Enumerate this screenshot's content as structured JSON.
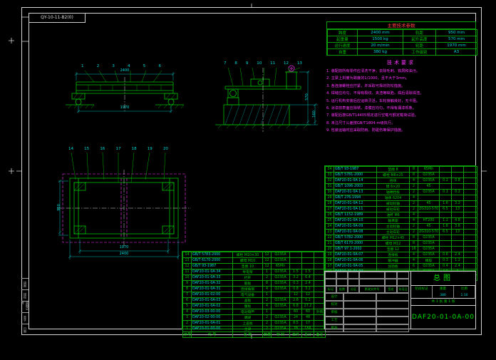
{
  "page": {
    "zone_label": "QY-10-11-B2(0)"
  },
  "spec_table": {
    "title": "主要技术参数",
    "rows": [
      [
        "跨度",
        "2400 mm",
        "轨距",
        "950 mm"
      ],
      [
        "起重量",
        "1500 kg",
        "起升高度",
        "570 mm"
      ],
      [
        "运行速度",
        "20 m/min",
        "轮距",
        "1970 mm"
      ],
      [
        "自重",
        "380 kg",
        "工作级别",
        "A3"
      ]
    ]
  },
  "notes": {
    "title": "技术要求",
    "items": [
      "1. 装配前所有零件应清洗干净，去除毛刺、铁屑和油污。",
      "2. 主梁上拱度为跨度的1/1000，且不大于3mm。",
      "3. 各连接螺栓应拧紧，并采取可靠的防松措施。",
      "4. 焊缝应均匀，不得有裂纹、夹渣等缺陷，焊后清除焊渣。",
      "5. 运行机构安装后应运转灵活，车轮接触良好，无卡阻。",
      "6. 涂漆前表面应除锈，漆膜应均匀，不得有漏漆现象。",
      "7. 装配后按GB/T14405规定进行空载与额定载荷试验。",
      "8. 未注尺寸公差按GB/T1804-m级执行。",
      "9. 包装运输时应采取防雨、防碰伤等保护措施。"
    ]
  },
  "bom_right": {
    "rows": [
      {
        "no": "34",
        "code": "GB/T 93-1987",
        "name": "垫圈 8",
        "qty": "8",
        "mat": "65Mn",
        "w1": "",
        "w2": "",
        "rem": ""
      },
      {
        "no": "33",
        "code": "GB/T 5781-2000",
        "name": "螺栓 M8×25",
        "qty": "8",
        "mat": "Q235A",
        "w1": "",
        "w2": "",
        "rem": ""
      },
      {
        "no": "32",
        "code": "DAF20-01-0A-14",
        "name": "挡块",
        "qty": "4",
        "mat": "Q235A",
        "w1": "0.2",
        "w2": "0.8",
        "rem": ""
      },
      {
        "no": "31",
        "code": "GB/T 1096-2003",
        "name": "键 6×20",
        "qty": "2",
        "mat": "45",
        "w1": "",
        "w2": "",
        "rem": ""
      },
      {
        "no": "30",
        "code": "DAF20-01-0A-13",
        "name": "轴端挡板",
        "qty": "2",
        "mat": "Q235A",
        "w1": "0.1",
        "w2": "0.2",
        "rem": ""
      },
      {
        "no": "29",
        "code": "GB/T 276-1994",
        "name": "轴承 6204",
        "qty": "4",
        "mat": "",
        "w1": "",
        "w2": "",
        "rem": ""
      },
      {
        "no": "28",
        "code": "DAF20-01-0A-12",
        "name": "被动轮轴",
        "qty": "2",
        "mat": "45",
        "w1": "1.6",
        "w2": "3.2",
        "rem": ""
      },
      {
        "no": "27",
        "code": "DAF20-01-0A-11",
        "name": "被动车轮",
        "qty": "2",
        "mat": "ZG310-570",
        "w1": "6.5",
        "w2": "13",
        "rem": ""
      },
      {
        "no": "26",
        "code": "GB/T 1152-1989",
        "name": "油杯 M6",
        "qty": "4",
        "mat": "",
        "w1": "",
        "w2": "",
        "rem": ""
      },
      {
        "no": "25",
        "code": "DAF20-01-0A-10",
        "name": "轴承座",
        "qty": "4",
        "mat": "HT200",
        "w1": "1.2",
        "w2": "4.8",
        "rem": ""
      },
      {
        "no": "24",
        "code": "DAF20-01-0A-09",
        "name": "主动轮轴",
        "qty": "2",
        "mat": "45",
        "w1": "1.8",
        "w2": "3.6",
        "rem": ""
      },
      {
        "no": "23",
        "code": "DAF20-01-0A-08",
        "name": "主动车轮",
        "qty": "2",
        "mat": "ZG310-570",
        "w1": "6.5",
        "w2": "13",
        "rem": ""
      },
      {
        "no": "22",
        "code": "GB/T 5782-2000",
        "name": "螺栓 M12×45",
        "qty": "8",
        "mat": "Q235A",
        "w1": "",
        "w2": "",
        "rem": ""
      },
      {
        "no": "21",
        "code": "GB/T 6170-2000",
        "name": "螺母 M12",
        "qty": "8",
        "mat": "Q235A",
        "w1": "",
        "w2": "",
        "rem": ""
      },
      {
        "no": "20",
        "code": "GB/T 97.1-2002",
        "name": "垫圈 12",
        "qty": "16",
        "mat": "Q235A",
        "w1": "",
        "w2": "",
        "rem": ""
      },
      {
        "no": "19",
        "code": "DAF20-01-0A-07",
        "name": "连接板",
        "qty": "4",
        "mat": "Q235A",
        "w1": "0.6",
        "w2": "2.4",
        "rem": ""
      },
      {
        "no": "18",
        "code": "DAF20-01-0A-06",
        "name": "缓冲器",
        "qty": "4",
        "mat": "橡胶",
        "w1": "0.3",
        "w2": "1.2",
        "rem": ""
      },
      {
        "no": "17",
        "code": "DAF20-01-0A-05",
        "name": "加劲板",
        "qty": "6",
        "mat": "Q235A",
        "w1": "0.4",
        "w2": "2.4",
        "rem": ""
      },
      {
        "no": "16",
        "code": "DAF20-01-0A-04",
        "name": "走台板",
        "qty": "2",
        "mat": "Q235A",
        "w1": "4.5",
        "w2": "9",
        "rem": ""
      },
      {
        "no": "15",
        "code": "DAF20-01-01-00",
        "name": "运行机构",
        "qty": "1",
        "mat": "",
        "w1": "26",
        "w2": "26",
        "rem": "组合件"
      }
    ]
  },
  "bom_left": {
    "header": [
      "序号",
      "代  号",
      "名  称",
      "数量",
      "材  料",
      "单件",
      "总计",
      "备注"
    ],
    "rows": [
      {
        "no": "14",
        "code": "GB/T 5783-2000",
        "name": "螺栓 M10×30",
        "qty": "12",
        "mat": "Q235A",
        "w1": "",
        "w2": "",
        "rem": ""
      },
      {
        "no": "13",
        "code": "GB/T 6170-2000",
        "name": "螺母 M10",
        "qty": "12",
        "mat": "Q235A",
        "w1": "",
        "w2": "",
        "rem": ""
      },
      {
        "no": "12",
        "code": "GB/T 93-1987",
        "name": "垫圈 10",
        "qty": "12",
        "mat": "65Mn",
        "w1": "",
        "w2": "",
        "rem": ""
      },
      {
        "no": "11",
        "code": "DAF20-01-0A-34",
        "name": "导电架",
        "qty": "1",
        "mat": "Q235A",
        "w1": "1.5",
        "w2": "1.5",
        "rem": ""
      },
      {
        "no": "10",
        "code": "DAF20-01-0A-33",
        "name": "栏杆",
        "qty": "2",
        "mat": "Q235A",
        "w1": "3.2",
        "w2": "6.4",
        "rem": ""
      },
      {
        "no": "9",
        "code": "DAF20-01-0A-32",
        "name": "筋板",
        "qty": "8",
        "mat": "Q235A",
        "w1": "0.3",
        "w2": "2.4",
        "rem": ""
      },
      {
        "no": "8",
        "code": "DAF20-01-0A-31",
        "name": "连接角钢",
        "qty": "4",
        "mat": "Q235A",
        "w1": "0.8",
        "w2": "3.2",
        "rem": ""
      },
      {
        "no": "7",
        "code": "DAF20-01-02-00",
        "name": "电气设备",
        "qty": "1",
        "mat": "",
        "w1": "12",
        "w2": "12",
        "rem": ""
      },
      {
        "no": "6",
        "code": "DAF20-01-0A-03",
        "name": "盖板",
        "qty": "2",
        "mat": "Q235A",
        "w1": "2.6",
        "w2": "5.2",
        "rem": ""
      },
      {
        "no": "5",
        "code": "DAF20-01-0A-02",
        "name": "腹板",
        "qty": "4",
        "mat": "Q235A",
        "w1": "6.8",
        "w2": "27.2",
        "rem": ""
      },
      {
        "no": "4",
        "code": "DAF20-03-00-00",
        "name": "电动葫芦",
        "qty": "1",
        "mat": "",
        "w1": "60",
        "w2": "60",
        "rem": "外购"
      },
      {
        "no": "3",
        "code": "DAF20-02-00-00",
        "name": "端梁",
        "qty": "2",
        "mat": "Q235A",
        "w1": "24",
        "w2": "48",
        "rem": ""
      },
      {
        "no": "2",
        "code": "DAF20-01-0A-01",
        "name": "上盖板",
        "qty": "2",
        "mat": "Q235A",
        "w1": "8.5",
        "w2": "17",
        "rem": ""
      },
      {
        "no": "1",
        "code": "DAF20-01-00-00",
        "name": "主梁",
        "qty": "2",
        "mat": "Q235A",
        "w1": "78",
        "w2": "156",
        "rem": ""
      }
    ]
  },
  "title_block": {
    "drawing_name": "总图",
    "drawing_no": "DAF20-01-0A-00",
    "stage_label": "阶段标记",
    "weight_label": "重量",
    "weight": "380",
    "scale_label": "比例",
    "scale": "1:10",
    "sheets": "共 1 张  第 1 张",
    "change_header": [
      "标记",
      "处数",
      "分区",
      "更改文件号",
      "签名",
      "年月日"
    ],
    "sig_rows": [
      [
        "设计",
        "",
        ""
      ],
      [
        "校对",
        "",
        ""
      ],
      [
        "审核",
        "",
        ""
      ],
      [
        "工艺",
        "",
        ""
      ],
      [
        "批准",
        "",
        ""
      ]
    ]
  },
  "margin_labels": [
    "描图",
    "描校",
    "底图总号",
    "签字",
    "日期"
  ],
  "callouts": {
    "front": [
      "1",
      "2",
      "3",
      "4",
      "5",
      "6"
    ],
    "section": [
      "7",
      "8",
      "9",
      "10",
      "11",
      "12",
      "13"
    ],
    "plan": [
      "14",
      "15",
      "16",
      "17",
      "18",
      "19",
      "20"
    ]
  },
  "dims": {
    "front_span": "2400",
    "front_wheelbase": "1970",
    "section_height": "570",
    "section_rail": "160",
    "plan_gauge": "950",
    "plan_wheelbase": "1970",
    "plan_span": "2400"
  }
}
